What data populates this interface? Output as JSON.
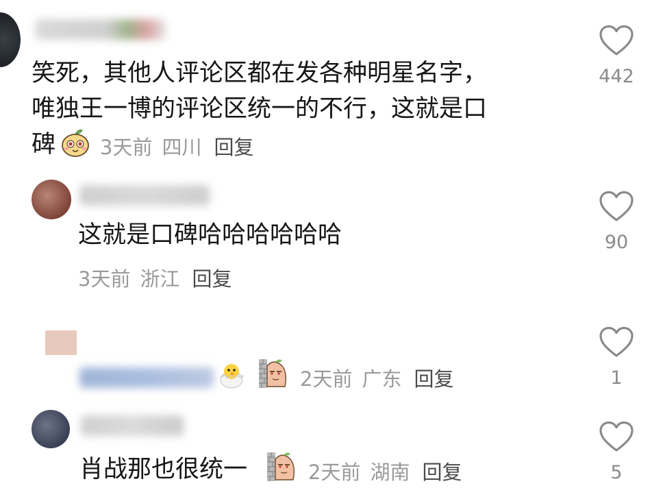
{
  "comments": [
    {
      "text_lines": [
        "笑死，其他人评论区都在发各种明星名字，",
        "唯独王一博的评论区统一的不行，这就是口",
        "碑"
      ],
      "time": "3天前",
      "location": "四川",
      "reply_label": "回复",
      "likes": "442",
      "sticker_icon": "peach-face-icon"
    },
    {
      "text_lines": [
        "这就是口碑哈哈哈哈哈哈"
      ],
      "time": "3天前",
      "location": "浙江",
      "reply_label": "回复",
      "likes": "90"
    },
    {
      "text_lines": [],
      "time": "2天前",
      "location": "广东",
      "reply_label": "回复",
      "likes": "1",
      "sticker_icons": [
        "chick-egg-icon",
        "wall-peek-icon"
      ]
    },
    {
      "text_lines": [
        "肖战那也很统一"
      ],
      "time": "2天前",
      "location": "湖南",
      "reply_label": "回复",
      "likes": "5",
      "sticker_icon": "wall-peek-icon"
    }
  ],
  "colors": {
    "text": "#161616",
    "meta": "#9a9a9a",
    "reply": "#4a4a4a",
    "heart_outline": "#8a8a8a"
  }
}
